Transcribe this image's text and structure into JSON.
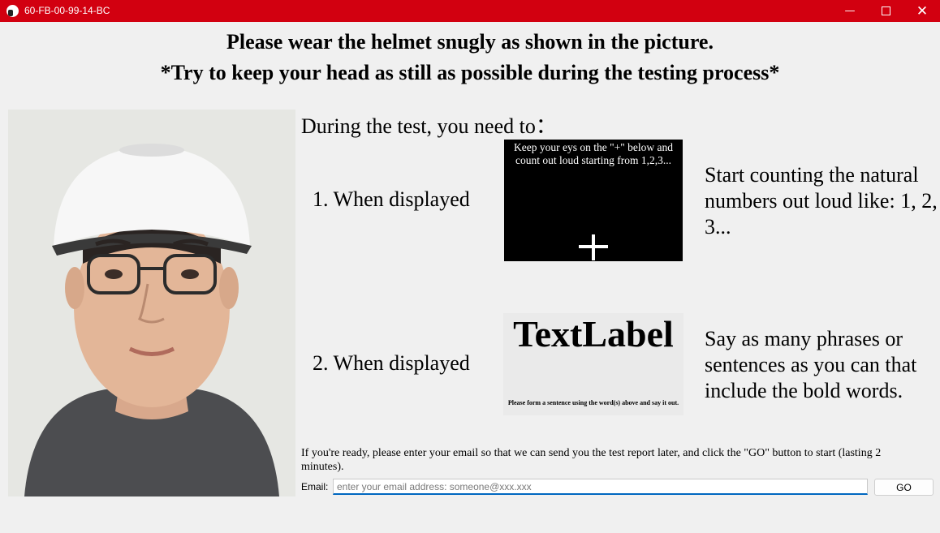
{
  "window": {
    "title": "60-FB-00-99-14-BC",
    "accent": "#d20010",
    "controls": {
      "minimize": "—",
      "close": "✕"
    }
  },
  "headings": {
    "line1": "Please wear the helmet snugly as shown in the picture.",
    "line2": "*Try to keep your head as still as possible during the testing process*"
  },
  "instructions": {
    "lead": "During the test, you need to：",
    "step1": {
      "label": "1. When displayed",
      "image_caption": "Keep your eys on the \"+\" below and count out loud starting from 1,2,3...",
      "description": "Start counting the natural numbers out loud like: 1, 2, 3..."
    },
    "step2": {
      "label": "2. When displayed",
      "word": "TextLabel",
      "image_caption": "Please form a sentence using the word(s) above and say it out.",
      "description": "Say as many phrases or sentences as you can that include the bold words."
    }
  },
  "footer": {
    "ready_text": "If you're ready, please enter your email so that we can send you the test report later, and click the \"GO\" button to start (lasting 2 minutes).",
    "email_label": "Email:",
    "email_value": "",
    "email_placeholder": "enter your email address: someone@xxx.xxx",
    "go_label": "GO"
  }
}
